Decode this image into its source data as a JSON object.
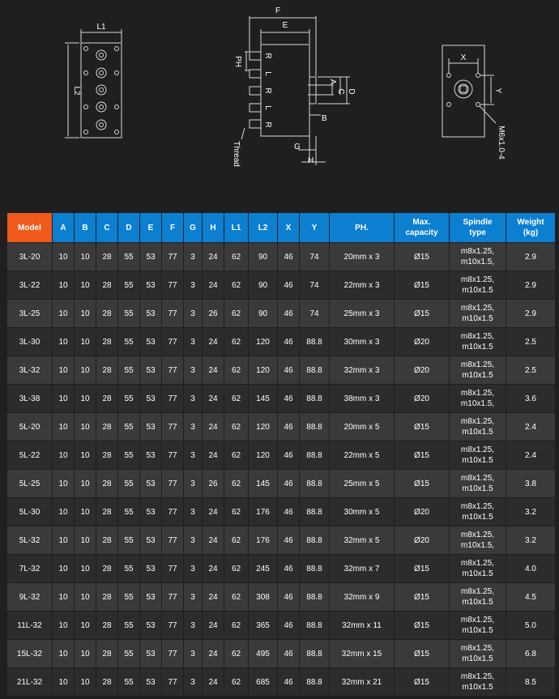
{
  "colors": {
    "header_blue": "#0c7fd0",
    "header_orange": "#ef5a1c",
    "row_dark": "#2c2c2c",
    "row_light": "#3a3a3a"
  },
  "drawing": {
    "labels": [
      "L1",
      "L2",
      "F",
      "E",
      "PH",
      "R",
      "L",
      "R",
      "L",
      "R",
      "A",
      "C",
      "D",
      "B",
      "G",
      "H",
      "Thread",
      "X",
      "Y",
      "M6x1.0-4"
    ]
  },
  "table": {
    "headers": [
      "Model",
      "A",
      "B",
      "C",
      "D",
      "E",
      "F",
      "G",
      "H",
      "L1",
      "L2",
      "X",
      "Y",
      "PH.",
      "Max.\ncapacity",
      "Spindle\ntype",
      "Weight\n(kg)"
    ],
    "rows": [
      [
        "3L-20",
        "10",
        "10",
        "28",
        "55",
        "53",
        "77",
        "3",
        "24",
        "62",
        "90",
        "46",
        "74",
        "20mm x 3",
        "Ø15",
        "m8x1.25,\nm10x1.5,",
        "2.9"
      ],
      [
        "3L-22",
        "10",
        "10",
        "28",
        "55",
        "53",
        "77",
        "3",
        "24",
        "62",
        "90",
        "46",
        "74",
        "22mm x 3",
        "Ø15",
        "m8x1.25,\nm10x1.5",
        "2.9"
      ],
      [
        "3L-25",
        "10",
        "10",
        "28",
        "55",
        "53",
        "77",
        "3",
        "26",
        "62",
        "90",
        "46",
        "74",
        "25mm x 3",
        "Ø15",
        "m8x1.25,\nm10x1.5",
        "2.9"
      ],
      [
        "3L-30",
        "10",
        "10",
        "28",
        "55",
        "53",
        "77",
        "3",
        "24",
        "62",
        "120",
        "46",
        "88.8",
        "30mm x 3",
        "Ø20",
        "m8x1.25,\nm10x1.5",
        "2.5"
      ],
      [
        "3L-32",
        "10",
        "10",
        "28",
        "55",
        "53",
        "77",
        "3",
        "24",
        "62",
        "120",
        "46",
        "88.8",
        "32mm x 3",
        "Ø20",
        "m8x1.25,\nm10x1.5",
        "2.5"
      ],
      [
        "3L-38",
        "10",
        "10",
        "28",
        "55",
        "53",
        "77",
        "3",
        "24",
        "62",
        "145",
        "46",
        "88.8",
        "38mm x 3",
        "Ø20",
        "m8x1.25,\nm10x1.5,",
        "3.6"
      ],
      [
        "5L-20",
        "10",
        "10",
        "28",
        "55",
        "53",
        "77",
        "3",
        "24",
        "62",
        "120",
        "46",
        "88.8",
        "20mm x 5",
        "Ø15",
        "m8x1.25,\nm10x1.5",
        "2.4"
      ],
      [
        "5L-22",
        "10",
        "10",
        "28",
        "55",
        "53",
        "77",
        "3",
        "24",
        "62",
        "120",
        "46",
        "88.8",
        "22mm x 5",
        "Ø15",
        "m8x1.25,\nm10x1.5",
        "2.4"
      ],
      [
        "5L-25",
        "10",
        "10",
        "28",
        "55",
        "53",
        "77",
        "3",
        "26",
        "62",
        "145",
        "46",
        "88.8",
        "25mm x 5",
        "Ø15",
        "m8x1.25,\nm10x1.5",
        "3.8"
      ],
      [
        "5L-30",
        "10",
        "10",
        "28",
        "55",
        "53",
        "77",
        "3",
        "24",
        "62",
        "176",
        "46",
        "88.8",
        "30mm x 5",
        "Ø20",
        "m8x1.25,\nm10x1.5",
        "3.2"
      ],
      [
        "5L-32",
        "10",
        "10",
        "28",
        "55",
        "53",
        "77",
        "3",
        "24",
        "62",
        "176",
        "46",
        "88.8",
        "32mm x 5",
        "Ø20",
        "m8x1.25,\nm10x1.5,",
        "3.2"
      ],
      [
        "7L-32",
        "10",
        "10",
        "28",
        "55",
        "53",
        "77",
        "3",
        "24",
        "62",
        "245",
        "46",
        "88.8",
        "32mm x 7",
        "Ø15",
        "m8x1.25,\nm10x1.5",
        "4.0"
      ],
      [
        "9L-32",
        "10",
        "10",
        "28",
        "55",
        "53",
        "77",
        "3",
        "24",
        "62",
        "308",
        "46",
        "88.8",
        "32mm x 9",
        "Ø15",
        "m8x1.25,\nm10x1.5",
        "4.5"
      ],
      [
        "11L-32",
        "10",
        "10",
        "28",
        "55",
        "53",
        "77",
        "3",
        "24",
        "62",
        "365",
        "46",
        "88.8",
        "32mm x 11",
        "Ø15",
        "m8x1.25,\nm10x1.5",
        "5.0"
      ],
      [
        "15L-32",
        "10",
        "10",
        "28",
        "55",
        "53",
        "77",
        "3",
        "24",
        "62",
        "495",
        "46",
        "88.8",
        "32mm x 15",
        "Ø15",
        "m8x1.25,\nm10x1.5",
        "6.8"
      ],
      [
        "21L-32",
        "10",
        "10",
        "28",
        "55",
        "53",
        "77",
        "3",
        "24",
        "62",
        "685",
        "46",
        "88.8",
        "32mm x 21",
        "Ø15",
        "m8x1.25,\nm10x1.5",
        "8.5"
      ]
    ]
  }
}
